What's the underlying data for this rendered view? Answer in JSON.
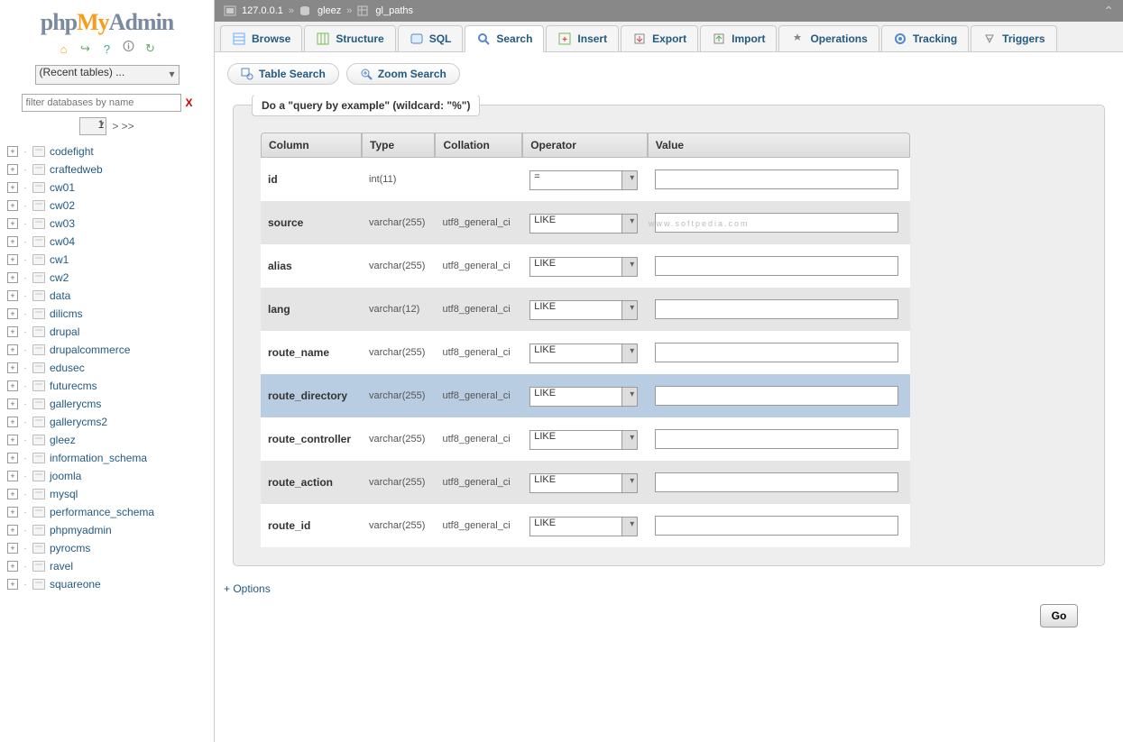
{
  "logo": {
    "p1": "php",
    "p2": "My",
    "p3": "Admin"
  },
  "recent_tables": "(Recent tables) ...",
  "filter_placeholder": "filter databases by name",
  "filter_clear": "X",
  "pager_value": "1",
  "pager_next": "> >>",
  "databases": [
    "codefight",
    "craftedweb",
    "cw01",
    "cw02",
    "cw03",
    "cw04",
    "cw1",
    "cw2",
    "data",
    "dilicms",
    "drupal",
    "drupalcommerce",
    "edusec",
    "futurecms",
    "gallerycms",
    "gallerycms2",
    "gleez",
    "information_schema",
    "joomla",
    "mysql",
    "performance_schema",
    "phpmyadmin",
    "pyrocms",
    "ravel",
    "squareone"
  ],
  "breadcrumb": {
    "server": "127.0.0.1",
    "db": "gleez",
    "table": "gl_paths"
  },
  "tabs": [
    {
      "label": "Browse",
      "icon": "browse"
    },
    {
      "label": "Structure",
      "icon": "structure"
    },
    {
      "label": "SQL",
      "icon": "sql"
    },
    {
      "label": "Search",
      "icon": "search",
      "active": true
    },
    {
      "label": "Insert",
      "icon": "insert"
    },
    {
      "label": "Export",
      "icon": "export"
    },
    {
      "label": "Import",
      "icon": "import"
    },
    {
      "label": "Operations",
      "icon": "operations"
    },
    {
      "label": "Tracking",
      "icon": "tracking"
    },
    {
      "label": "Triggers",
      "icon": "triggers"
    }
  ],
  "subtabs": [
    {
      "label": "Table Search",
      "icon": "table-search"
    },
    {
      "label": "Zoom Search",
      "icon": "zoom-search"
    }
  ],
  "panel_title": "Do a \"query by example\" (wildcard: \"%\")",
  "grid_headers": {
    "column": "Column",
    "type": "Type",
    "collation": "Collation",
    "operator": "Operator",
    "value": "Value"
  },
  "rows": [
    {
      "column": "id",
      "type": "int(11)",
      "collation": "",
      "operator": "=",
      "value": "",
      "hl": false
    },
    {
      "column": "source",
      "type": "varchar(255)",
      "collation": "utf8_general_ci",
      "operator": "LIKE",
      "value": "",
      "hl": false
    },
    {
      "column": "alias",
      "type": "varchar(255)",
      "collation": "utf8_general_ci",
      "operator": "LIKE",
      "value": "",
      "hl": false
    },
    {
      "column": "lang",
      "type": "varchar(12)",
      "collation": "utf8_general_ci",
      "operator": "LIKE",
      "value": "",
      "hl": false
    },
    {
      "column": "route_name",
      "type": "varchar(255)",
      "collation": "utf8_general_ci",
      "operator": "LIKE",
      "value": "",
      "hl": false
    },
    {
      "column": "route_directory",
      "type": "varchar(255)",
      "collation": "utf8_general_ci",
      "operator": "LIKE",
      "value": "",
      "hl": true
    },
    {
      "column": "route_controller",
      "type": "varchar(255)",
      "collation": "utf8_general_ci",
      "operator": "LIKE",
      "value": "",
      "hl": false
    },
    {
      "column": "route_action",
      "type": "varchar(255)",
      "collation": "utf8_general_ci",
      "operator": "LIKE",
      "value": "",
      "hl": false
    },
    {
      "column": "route_id",
      "type": "varchar(255)",
      "collation": "utf8_general_ci",
      "operator": "LIKE",
      "value": "",
      "hl": false
    }
  ],
  "options_link": "+ Options",
  "go_button": "Go",
  "watermark": "www.softpedia.com"
}
